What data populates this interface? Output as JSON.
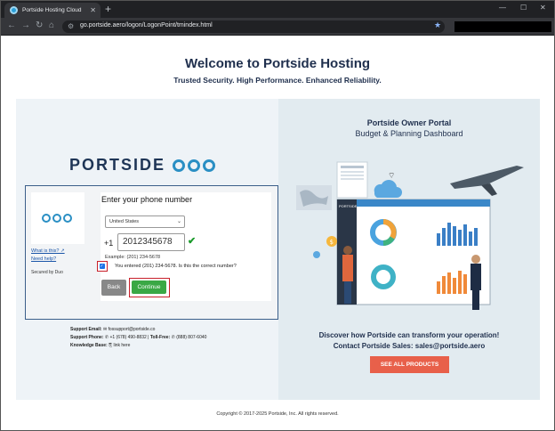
{
  "browser": {
    "tab_title": "Portside Hosting Cloud",
    "new_tab": "+",
    "url": "go.portside.aero/logon/LogonPoint/tmindex.html",
    "win_minimize": "—",
    "win_restore": "☐",
    "win_close": "✕"
  },
  "header": {
    "title": "Welcome to Portside Hosting",
    "tagline": "Trusted Security. High Performance. Enhanced Reliability."
  },
  "left": {
    "logo_text": "PORTSIDE",
    "duo": {
      "title": "Enter your phone number",
      "what_is_this": "What is this? ↗",
      "need_help": "Need help?",
      "secured_by": "Secured by Duo",
      "country": "United States",
      "country_code": "+1",
      "phone_value": "2012345678",
      "example": "Example: (201) 234-5678",
      "confirm_text": "You entered (201) 234-5678. Is this the correct number?",
      "confirm_checked": true,
      "back_label": "Back",
      "continue_label": "Continue"
    },
    "support": {
      "email_label": "Support Email:",
      "email_value": "✉ fossupport@portside.co",
      "phone_label": "Support Phone:",
      "phone_value": "✆ +1 (678) 490-8832",
      "tollfree_label": "Toll-Free:",
      "tollfree_value": "✆ (888) 807-6040",
      "kb_label": "Knowledge Base:",
      "kb_value": "⎘ link here"
    }
  },
  "right": {
    "title": "Portside Owner Portal",
    "subtitle": "Budget & Planning Dashboard",
    "dashboard_brand": "PORTSIDE",
    "discover": "Discover how Portside can transform your operation!",
    "contact": "Contact Portside Sales: sales@portside.aero",
    "cta": "SEE ALL PRODUCTS"
  },
  "footer": {
    "copyright": "Copyright © 2017-2025 Portside, Inc. All rights reserved."
  },
  "colors": {
    "navy": "#1f2f4d",
    "accent_blue": "#2a8fc4",
    "continue_green": "#3aa845",
    "cta_orange": "#e8604a",
    "highlight_red": "#c8202a"
  }
}
